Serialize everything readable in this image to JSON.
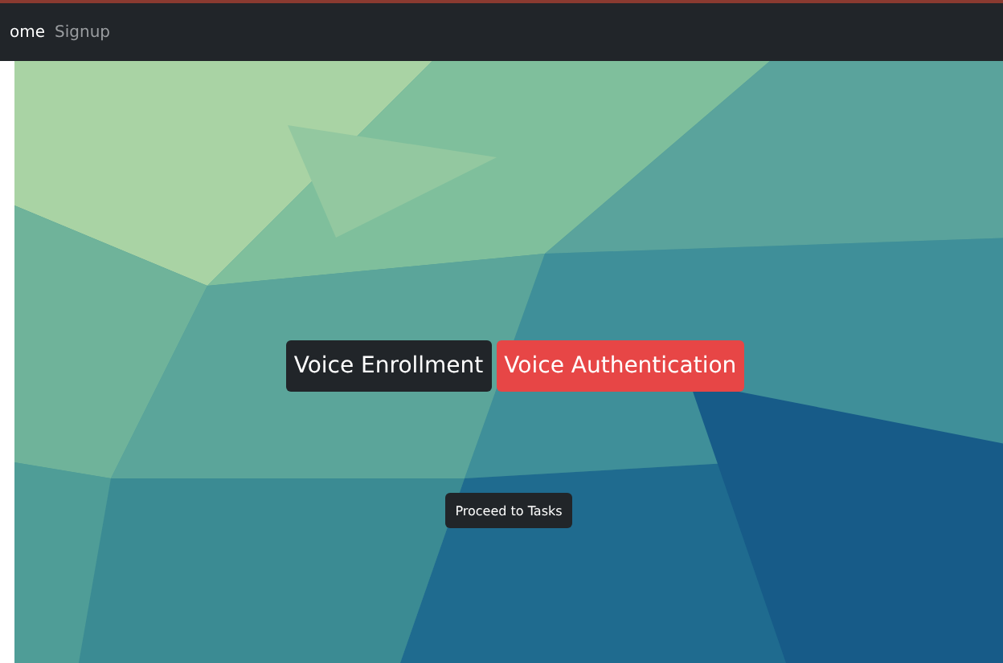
{
  "navbar": {
    "links": [
      {
        "label": "ome",
        "selected": true
      },
      {
        "label": "Signup",
        "selected": false
      }
    ]
  },
  "hero": {
    "kind": "picture",
    "buttons": [
      {
        "label": "Voice Enrollment",
        "kind": "dark"
      },
      {
        "label": "Voice Authentication",
        "kind": "danger"
      }
    ],
    "proceed": {
      "label": "Proceed to Tasks"
    }
  }
}
